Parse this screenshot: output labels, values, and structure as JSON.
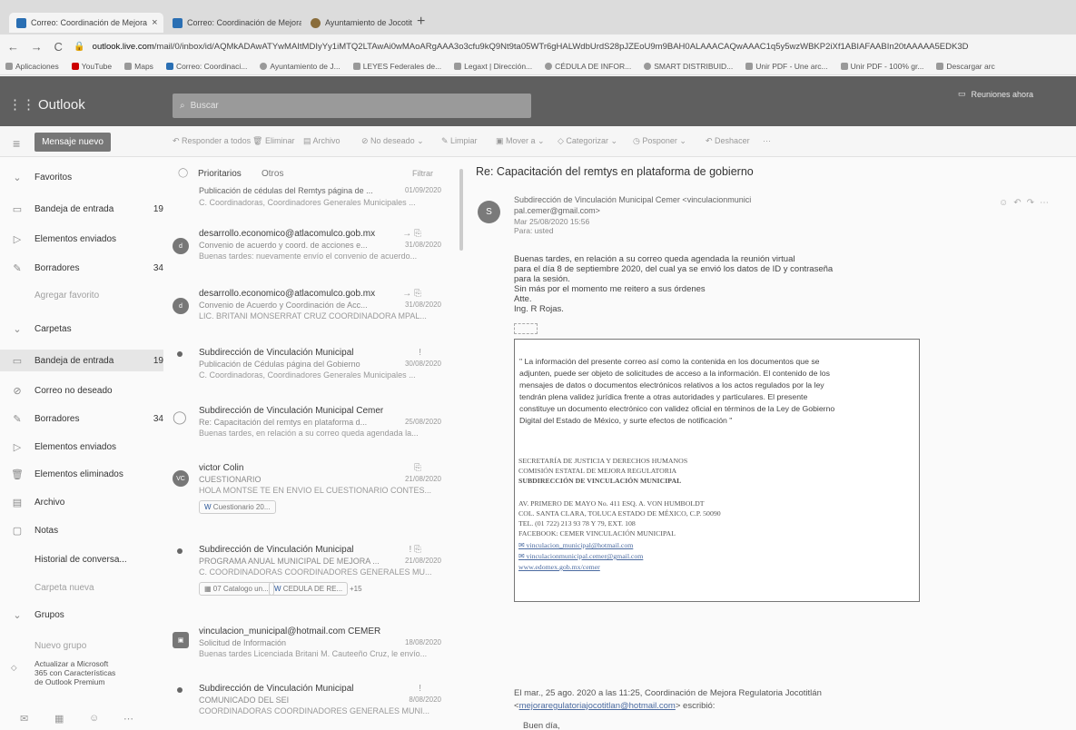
{
  "browser": {
    "tabs": [
      {
        "title": "Correo: Coordinación de Mejora",
        "close": "×"
      },
      {
        "title": "Correo: Coordinación de Mejora",
        "close": "×"
      },
      {
        "title": "Ayuntamiento de Jocotitlán - Ad",
        "close": "×"
      }
    ],
    "new_tab": "+",
    "url_host": "outlook.live.com",
    "url_path": "/mail/0/inbox/id/AQMkADAwATYwMAItMDIyYy1iMTQ2LTAwAi0wMAoARgAAA3o3cfu9kQ9Nt9ta05WTr6gHALWdbUrdS28pJZEoU9m9BAH0ALAAACAQwAAAC1q5y5wzWBKP2iXf1ABIAFAABIn20tAAAAA5EDK3D",
    "bookmarks": [
      "Aplicaciones",
      "YouTube",
      "Maps",
      "Correo: Coordinaci...",
      "Ayuntamiento de J...",
      "LEYES Federales de...",
      "Legaxt | Dirección...",
      "CÉDULA DE INFOR...",
      "SMART DISTRIBUID...",
      "Unir PDF - Une arc...",
      "Unir PDF - 100% gr...",
      "Descargar arc"
    ]
  },
  "outlook": {
    "brand": "Outlook",
    "search_placeholder": "Buscar",
    "try_label": "Reuniones ahora",
    "new_mail": "Mensaje nuevo",
    "commands": [
      "Responder a todos",
      "Eliminar",
      "Archivo",
      "No deseado",
      "Limpiar",
      "Mover a",
      "Categorizar",
      "Posponer",
      "Deshacer",
      "···"
    ]
  },
  "nav": {
    "favorites_header": "Favoritos",
    "favorites": [
      {
        "label": "Bandeja de entrada",
        "count": "19"
      },
      {
        "label": "Elementos enviados",
        "count": ""
      },
      {
        "label": "Borradores",
        "count": "34"
      },
      {
        "label": "Agregar favorito",
        "count": ""
      }
    ],
    "folders_header": "Carpetas",
    "folders": [
      {
        "label": "Bandeja de entrada",
        "count": "19"
      },
      {
        "label": "Correo no deseado",
        "count": ""
      },
      {
        "label": "Borradores",
        "count": "34"
      },
      {
        "label": "Elementos enviados",
        "count": ""
      },
      {
        "label": "Elementos eliminados",
        "count": ""
      },
      {
        "label": "Archivo",
        "count": ""
      },
      {
        "label": "Notas",
        "count": ""
      },
      {
        "label": "Historial de conversa...",
        "count": ""
      },
      {
        "label": "Carpeta nueva",
        "count": ""
      }
    ],
    "groups_header": "Grupos",
    "new_group": "Nuevo grupo",
    "upgrade": [
      "Actualizar a Microsoft",
      "365 con Características",
      "de Outlook Premium"
    ]
  },
  "list": {
    "tab_focused": "Prioritarios",
    "tab_other": "Otros",
    "filter": "Filtrar",
    "messages": [
      {
        "sender": "",
        "subject": "Publicación de cédulas del Remtys página de ...",
        "date": "01/09/2020",
        "preview": "C. Coordinadoras, Coordinadores Generales Municipales ..."
      },
      {
        "sender": "desarrollo.economico@atlacomulco.gob.mx",
        "subject": "Convenio de acuerdo y coord. de acciones e...",
        "date": "31/08/2020",
        "preview": "Buenas tardes: nuevamente envío el convenio de acuerdo..."
      },
      {
        "sender": "desarrollo.economico@atlacomulco.gob.mx",
        "subject": "Convenio de Acuerdo y Coordinación de Acc...",
        "date": "31/08/2020",
        "preview": "LIC. BRITANI MONSERRAT CRUZ COORDINADORA MPAL..."
      },
      {
        "sender": "Subdirección de Vinculación Municipal",
        "subject": "Publicación de Cédulas página del Gobierno",
        "date": "30/08/2020",
        "preview": "C. Coordinadoras, Coordinadores Generales Municipales ..."
      },
      {
        "sender": "Subdirección de Vinculación Municipal Cemer",
        "subject": "Re: Capacitación del remtys en plataforma d...",
        "date": "25/08/2020",
        "preview": "Buenas tardes, en relación a su correo queda agendada la..."
      },
      {
        "sender": "victor Colin",
        "subject": "CUESTIONARIO",
        "date": "21/08/2020",
        "preview": "HOLA MONTSE TE EN ENVIO EL CUESTIONARIO CONTES...",
        "avatar": "VC",
        "chip": "Cuestionario 20..."
      },
      {
        "sender": "Subdirección de Vinculación Municipal",
        "subject": "PROGRAMA ANUAL MUNICIPAL DE MEJORA ...",
        "date": "21/08/2020",
        "preview": "C. COORDINADORAS COORDINADORES GENERALES MU...",
        "chips": [
          "07 Catalogo un...",
          "CEDULA DE RE...",
          "+15"
        ]
      },
      {
        "sender": "vinculacion_municipal@hotmail.com CEMER",
        "subject": "Solicitud de Información",
        "date": "18/08/2020",
        "preview": "Buenas tardes Licenciada Britani M. Cauteeño Cruz, le envío..."
      },
      {
        "sender": "Subdirección de Vinculación Municipal",
        "subject": "COMUNICADO DEL SEI",
        "date": "8/08/2020",
        "preview": "COORDINADORAS COORDINADORES GENERALES MUNI..."
      }
    ]
  },
  "reading": {
    "title": "Re: Capacitación del remtys en plataforma de gobierno",
    "avatar": "S",
    "from": "Subdirección de Vinculación Municipal Cemer <vinculacionmunici",
    "from2": "pal.cemer@gmail.com>",
    "date": "Mar 25/08/2020 15:56",
    "to": "Para: usted",
    "body": [
      "Buenas tardes, en relación a su correo queda agendada la reunión virtual",
      "para el día 8 de septiembre 2020, del cual ya se envió los datos de ID y contraseña",
      "para la sesión.",
      "Sin más por el momento me reitero a sus órdenes",
      "Atte.",
      "Ing. R Rojas."
    ],
    "disclaimer": [
      "\" La información del presente correo así como la contenida en los documentos que se",
      "adjunten, puede ser objeto de solicitudes de acceso a la información. El contenido de los",
      "mensajes de datos o documentos electrónicos relativos a los actos regulados por la ley",
      "tendrán plena validez jurídica frente a otras autoridades y particulares. El presente",
      "constituye un documento electrónico con validez oficial en términos de la Ley de Gobierno",
      "Digital del Estado de México, y surte efectos de notificación \""
    ],
    "sig": [
      "SECRETARÍA DE JUSTICIA Y DERECHOS HUMANOS",
      "COMISIÓN ESTATAL DE MEJORA REGULATORIA",
      "SUBDIRECCIÓN DE VINCULACIÓN MUNICIPAL",
      "AV. PRIMERO DE MAYO No. 411 ESQ. A. VON HUMBOLDT",
      "COL. SANTA CLARA, TOLUCA ESTADO DE MÉXICO, C.P. 50090",
      "TEL. (01 722) 213 93 78 Y 79, EXT. 108",
      "FACEBOOK: CEMER VINCULACIÓN MUNICIPAL"
    ],
    "links": [
      "vinculacion_municipal@hotmail.com",
      "vinculacionmunicipal.cemer@gmail.com",
      "www.edomex.gob.mx/cemer"
    ],
    "reply_header": "El mar., 25 ago. 2020 a las 11:25, Coordinación de Mejora Regulatoria Jocotitlán",
    "reply_email": "mejoraregulatoriajocotitlan@hotmail.com",
    "reply_tail": "escribió:",
    "reply_greet": "Buen día,"
  }
}
